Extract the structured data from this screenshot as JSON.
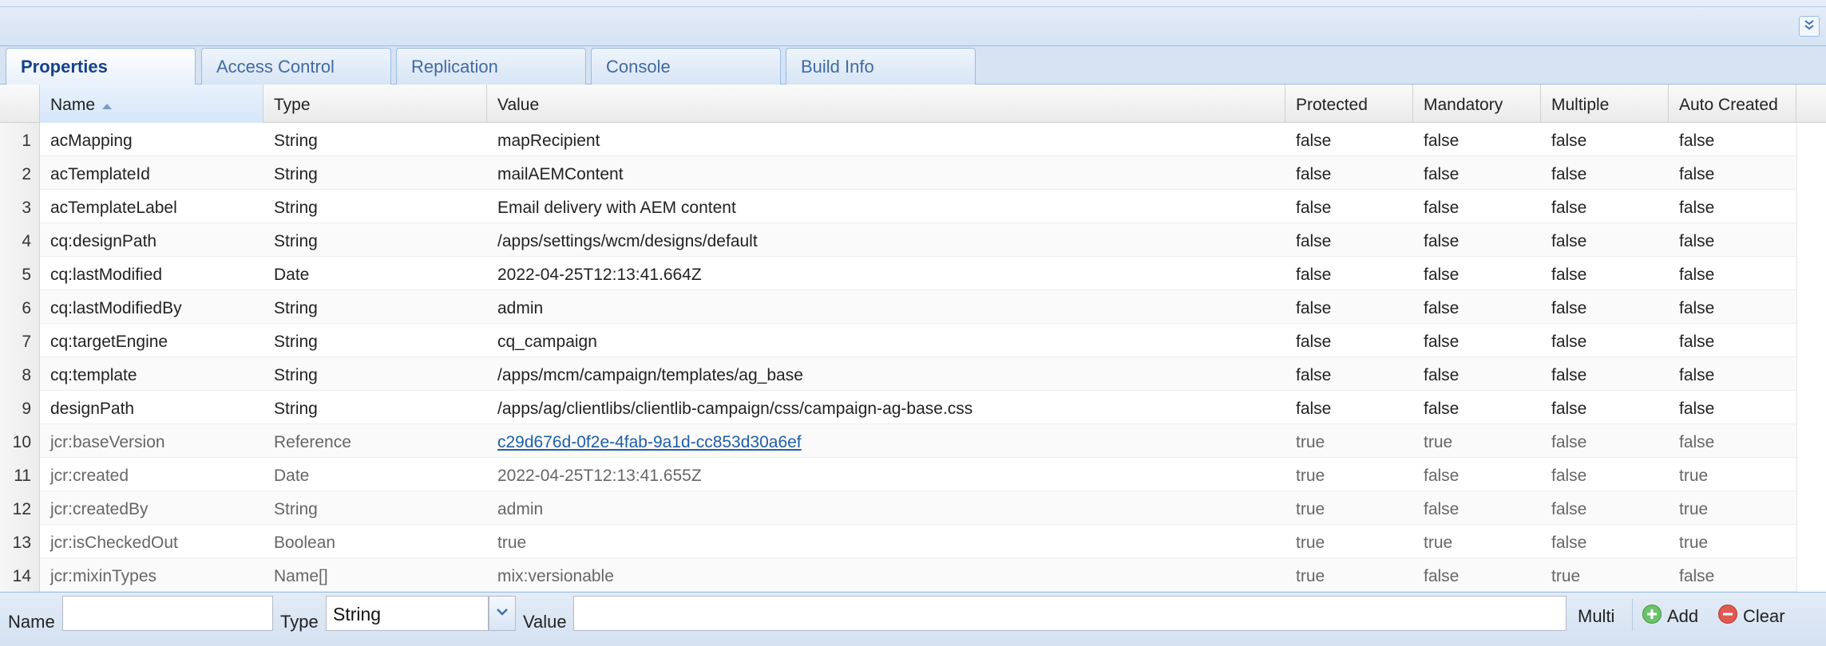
{
  "tabs": [
    {
      "label": "Properties",
      "active": true
    },
    {
      "label": "Access Control",
      "active": false
    },
    {
      "label": "Replication",
      "active": false
    },
    {
      "label": "Console",
      "active": false
    },
    {
      "label": "Build Info",
      "active": false
    }
  ],
  "grid": {
    "columns": [
      "Name",
      "Type",
      "Value",
      "Protected",
      "Mandatory",
      "Multiple",
      "Auto Created"
    ],
    "sorted_column": "Name",
    "sort_direction": "ascending",
    "rows": [
      {
        "n": "1",
        "name": "acMapping",
        "type": "String",
        "value": "mapRecipient",
        "protected": "false",
        "mandatory": "false",
        "multiple": "false",
        "auto": "false"
      },
      {
        "n": "2",
        "name": "acTemplateId",
        "type": "String",
        "value": "mailAEMContent",
        "protected": "false",
        "mandatory": "false",
        "multiple": "false",
        "auto": "false"
      },
      {
        "n": "3",
        "name": "acTemplateLabel",
        "type": "String",
        "value": "Email delivery with AEM content",
        "protected": "false",
        "mandatory": "false",
        "multiple": "false",
        "auto": "false"
      },
      {
        "n": "4",
        "name": "cq:designPath",
        "type": "String",
        "value": "/apps/settings/wcm/designs/default",
        "protected": "false",
        "mandatory": "false",
        "multiple": "false",
        "auto": "false"
      },
      {
        "n": "5",
        "name": "cq:lastModified",
        "type": "Date",
        "value": "2022-04-25T12:13:41.664Z",
        "protected": "false",
        "mandatory": "false",
        "multiple": "false",
        "auto": "false"
      },
      {
        "n": "6",
        "name": "cq:lastModifiedBy",
        "type": "String",
        "value": "admin",
        "protected": "false",
        "mandatory": "false",
        "multiple": "false",
        "auto": "false"
      },
      {
        "n": "7",
        "name": "cq:targetEngine",
        "type": "String",
        "value": "cq_campaign",
        "protected": "false",
        "mandatory": "false",
        "multiple": "false",
        "auto": "false"
      },
      {
        "n": "8",
        "name": "cq:template",
        "type": "String",
        "value": "/apps/mcm/campaign/templates/ag_base",
        "protected": "false",
        "mandatory": "false",
        "multiple": "false",
        "auto": "false"
      },
      {
        "n": "9",
        "name": "designPath",
        "type": "String",
        "value": "/apps/ag/clientlibs/clientlib-campaign/css/campaign-ag-base.css",
        "protected": "false",
        "mandatory": "false",
        "multiple": "false",
        "auto": "false"
      },
      {
        "n": "10",
        "name": "jcr:baseVersion",
        "type": "Reference",
        "value": "c29d676d-0f2e-4fab-9a1d-cc853d30a6ef",
        "link": true,
        "protected": "true",
        "mandatory": "true",
        "multiple": "false",
        "auto": "false"
      },
      {
        "n": "11",
        "name": "jcr:created",
        "type": "Date",
        "value": "2022-04-25T12:13:41.655Z",
        "protected": "true",
        "mandatory": "false",
        "multiple": "false",
        "auto": "true"
      },
      {
        "n": "12",
        "name": "jcr:createdBy",
        "type": "String",
        "value": "admin",
        "protected": "true",
        "mandatory": "false",
        "multiple": "false",
        "auto": "true"
      },
      {
        "n": "13",
        "name": "jcr:isCheckedOut",
        "type": "Boolean",
        "value": "true",
        "protected": "true",
        "mandatory": "true",
        "multiple": "false",
        "auto": "true"
      },
      {
        "n": "14",
        "name": "jcr:mixinTypes",
        "type": "Name[]",
        "value": "mix:versionable",
        "protected": "true",
        "mandatory": "false",
        "multiple": "true",
        "auto": "false"
      }
    ]
  },
  "editor": {
    "name_label": "Name",
    "name_value": "",
    "type_label": "Type",
    "type_value": "String",
    "value_label": "Value",
    "value_value": "",
    "multi_label": "Multi",
    "add_label": "Add",
    "clear_label": "Clear"
  },
  "colors": {
    "accent": "#15428b",
    "border": "#99bbe8",
    "link": "#1f5fa8",
    "add_icon": "#5cb85c",
    "clear_icon": "#d9534f"
  },
  "icons": {
    "collapse": "double-chevron-down-icon",
    "sort": "sort-ascending-icon",
    "dropdown": "chevron-down-icon",
    "add": "plus-circle-icon",
    "clear": "minus-circle-icon"
  }
}
